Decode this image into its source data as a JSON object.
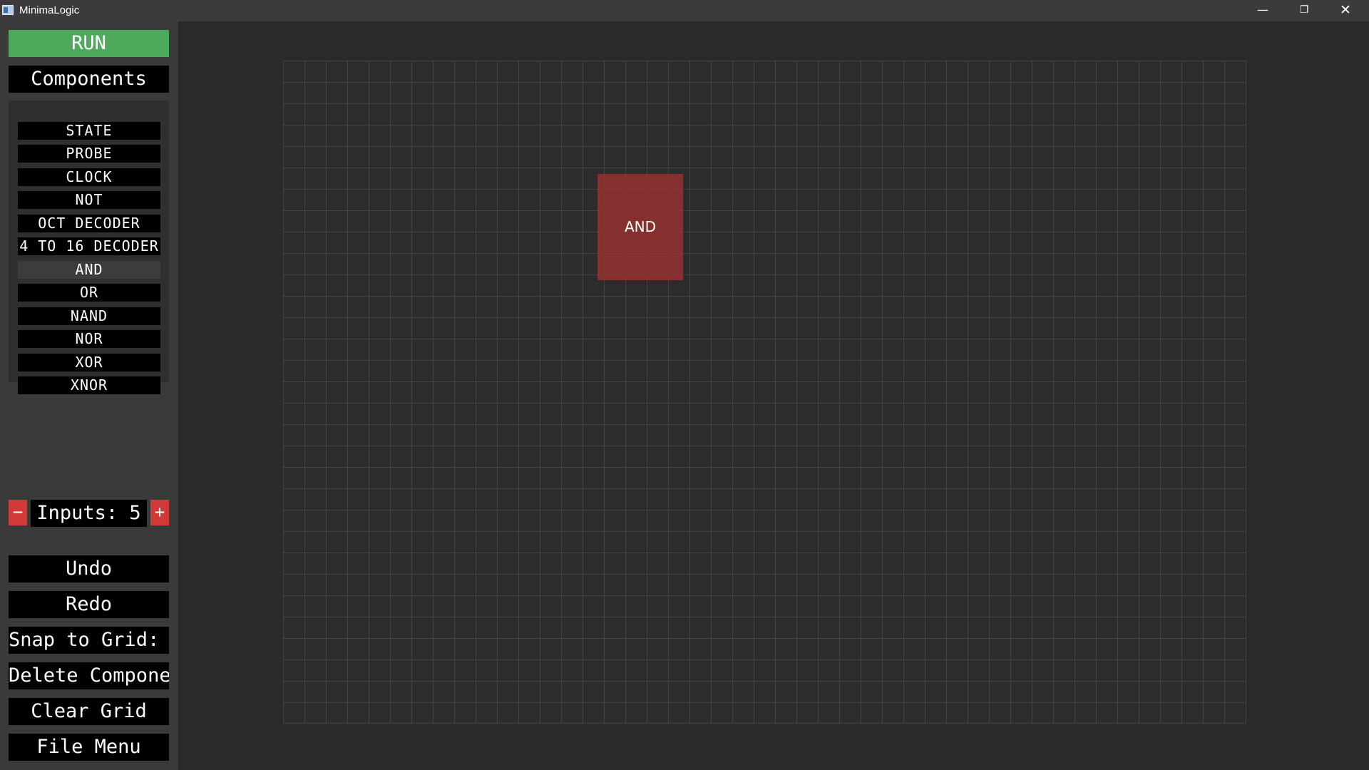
{
  "window": {
    "title": "MinimaLogic",
    "controls": {
      "minimize": "—",
      "maximize": "❐",
      "close": "✕"
    }
  },
  "sidebar": {
    "run_label": "RUN",
    "components_label": "Components",
    "components": [
      "STATE",
      "PROBE",
      "CLOCK",
      "NOT",
      "OCT DECODER",
      "4 TO 16 DECODER",
      "AND",
      "OR",
      "NAND",
      "NOR",
      "XOR",
      "XNOR"
    ],
    "selected_component": "AND",
    "inputs": {
      "minus_label": "−",
      "label": "Inputs: 5",
      "plus_label": "+",
      "value": 5
    },
    "actions": {
      "undo": "Undo",
      "redo": "Redo",
      "snap": "Snap to Grid: Off",
      "delete": "Delete Component",
      "clear": "Clear Grid",
      "file_menu": "File Menu"
    }
  },
  "canvas": {
    "gate_label": "AND"
  },
  "colors": {
    "run": "#4daa5c",
    "stepper": "#d23a3a",
    "gate": "#963030",
    "background": "#2a2a2a",
    "sidebar": "#3a3a3a"
  }
}
